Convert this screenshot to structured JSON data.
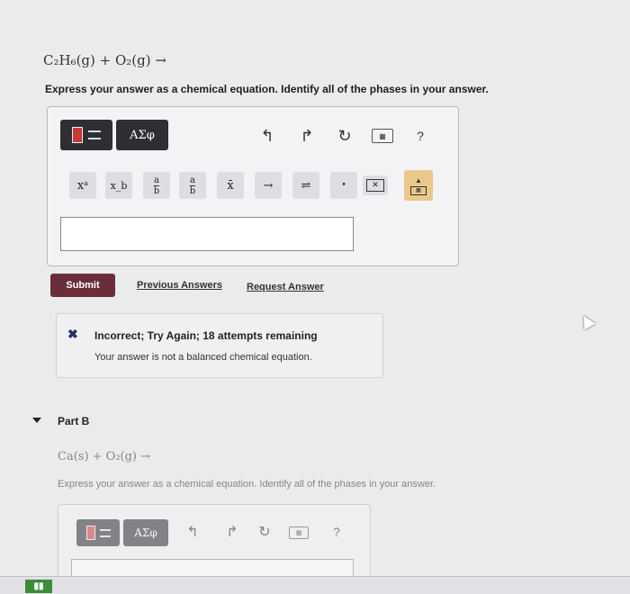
{
  "part_a": {
    "equation": "C₂H₆(g) + O₂(g) →",
    "instructions": "Express your answer as a chemical equation. Identify all of the phases in your answer.",
    "toolbar": {
      "symbols_label": "ΑΣφ",
      "help_label": "?"
    },
    "templates": {
      "superscript": "xᵃ",
      "subscript": "x_b",
      "fraction_num": "a",
      "fraction_den": "b",
      "overline": "x̄",
      "arrow": "→",
      "equilibrium": "⇌",
      "dot": "•"
    },
    "answer_value": "",
    "submit_label": "Submit",
    "previous_answers_label": "Previous Answers",
    "request_answer_label": "Request Answer",
    "feedback": {
      "icon": "✖",
      "title": "Incorrect; Try Again; 18 attempts remaining",
      "message": "Your answer is not a balanced chemical equation."
    }
  },
  "part_b": {
    "heading": "Part B",
    "equation": "Ca(s) + O₂(g) →",
    "instructions": "Express your answer as a chemical equation. Identify all of the phases in your answer.",
    "toolbar": {
      "symbols_label": "ΑΣφ",
      "help_label": "?"
    }
  },
  "colors": {
    "accent_dark": "#2f2f33",
    "submit": "#6a2e3a",
    "incorrect": "#2b2f6b",
    "keyboard_tab": "#e9c98a"
  }
}
